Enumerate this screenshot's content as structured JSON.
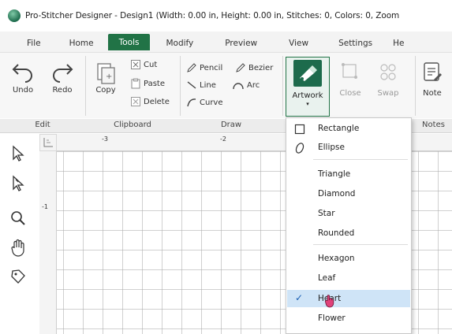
{
  "window": {
    "title": "Pro-Stitcher Designer - Design1 (Width: 0.00 in, Height: 0.00 in, Stitches: 0, Colors: 0, Zoom"
  },
  "menu": {
    "tabs": [
      {
        "label": "File"
      },
      {
        "label": "Home"
      },
      {
        "label": "Tools",
        "active": true
      },
      {
        "label": "Modify"
      },
      {
        "label": "Preview"
      },
      {
        "label": "View"
      },
      {
        "label": "Settings"
      },
      {
        "label": "He"
      }
    ]
  },
  "ribbon": {
    "edit": {
      "undo": "Undo",
      "redo": "Redo",
      "group": "Edit"
    },
    "clipboard": {
      "copy": "Copy",
      "cut": "Cut",
      "paste": "Paste",
      "delete": "Delete",
      "group": "Clipboard"
    },
    "draw": {
      "pencil": "Pencil",
      "bezier": "Bezier",
      "line": "Line",
      "arc": "Arc",
      "curve": "Curve",
      "group": "Draw"
    },
    "artwork": {
      "label": "Artwork",
      "caret": "▾"
    },
    "close": "Close",
    "swap": "Swap",
    "notes": {
      "note": "Note",
      "group": "Notes"
    },
    "accent_color": "#217346"
  },
  "ruler": {
    "top_labels": [
      "-3",
      "-2"
    ],
    "left_labels": [
      "-1"
    ]
  },
  "artwork_menu": {
    "items": [
      {
        "label": "Rectangle",
        "icon": "square-icon"
      },
      {
        "label": "Ellipse",
        "icon": "ellipse-icon"
      },
      {
        "label": "Triangle"
      },
      {
        "label": "Diamond"
      },
      {
        "label": "Star"
      },
      {
        "label": "Rounded"
      },
      {
        "label": "Hexagon"
      },
      {
        "label": "Leaf"
      },
      {
        "label": "Heart",
        "checked": true,
        "highlighted": true
      },
      {
        "label": "Flower"
      }
    ],
    "check_glyph": "✓"
  }
}
